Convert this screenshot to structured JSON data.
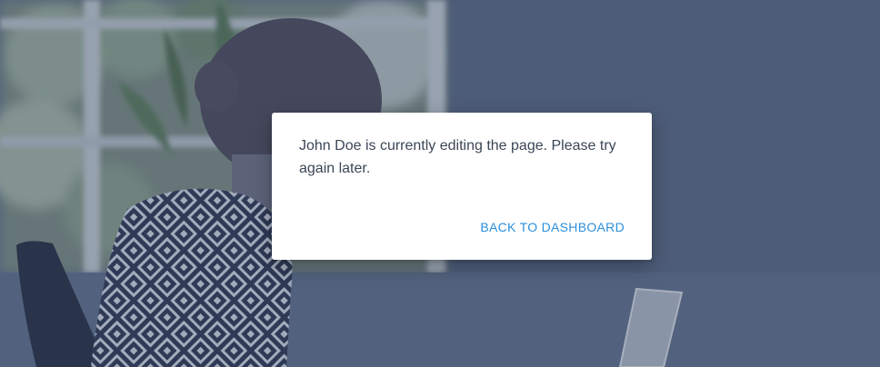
{
  "background": {
    "image": "office-worker-at-laptop-photo",
    "overlay_color": "#3c4d6e"
  },
  "dialog": {
    "message": "John Doe is currently editing the page. Please try again later.",
    "action_label": "BACK TO DASHBOARD",
    "action_color": "#2b8fdc"
  }
}
